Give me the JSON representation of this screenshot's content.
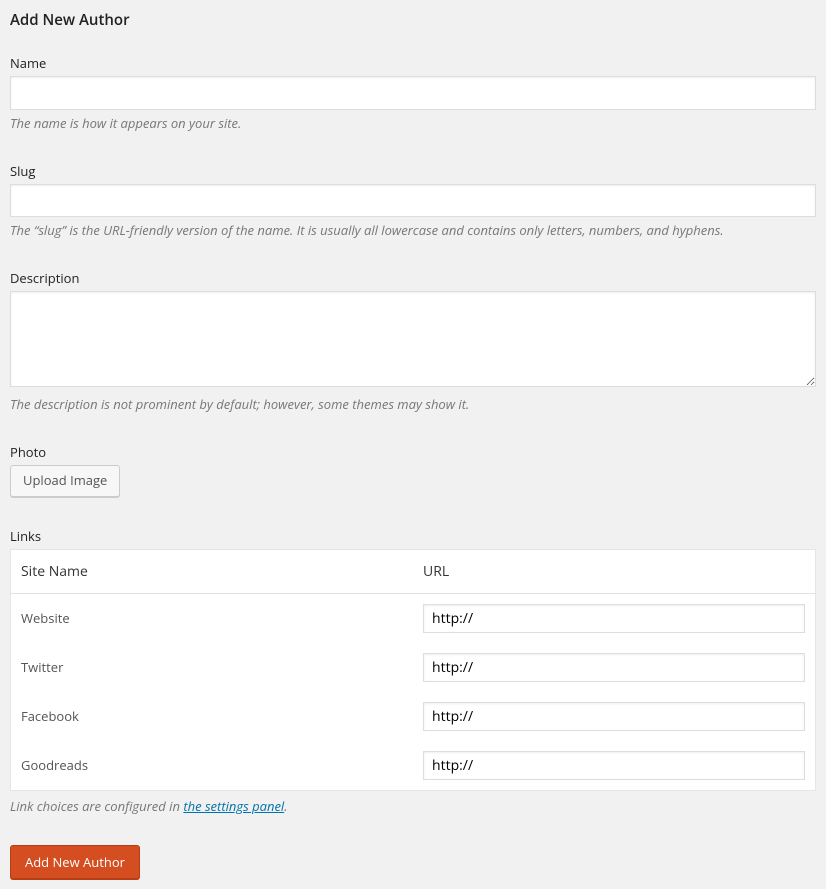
{
  "page_title": "Add New Author",
  "fields": {
    "name": {
      "label": "Name",
      "value": "",
      "hint": "The name is how it appears on your site."
    },
    "slug": {
      "label": "Slug",
      "value": "",
      "hint": "The “slug” is the URL-friendly version of the name. It is usually all lowercase and contains only letters, numbers, and hyphens."
    },
    "description": {
      "label": "Description",
      "value": "",
      "hint": "The description is not prominent by default; however, some themes may show it."
    },
    "photo": {
      "label": "Photo",
      "button_label": "Upload Image"
    }
  },
  "links": {
    "label": "Links",
    "headers": {
      "site_name": "Site Name",
      "url": "URL"
    },
    "rows": [
      {
        "site_name": "Website",
        "url": "http://"
      },
      {
        "site_name": "Twitter",
        "url": "http://"
      },
      {
        "site_name": "Facebook",
        "url": "http://"
      },
      {
        "site_name": "Goodreads",
        "url": "http://"
      }
    ],
    "hint_prefix": "Link choices are configured in ",
    "hint_link_text": "the settings panel",
    "hint_suffix": "."
  },
  "submit_label": "Add New Author"
}
